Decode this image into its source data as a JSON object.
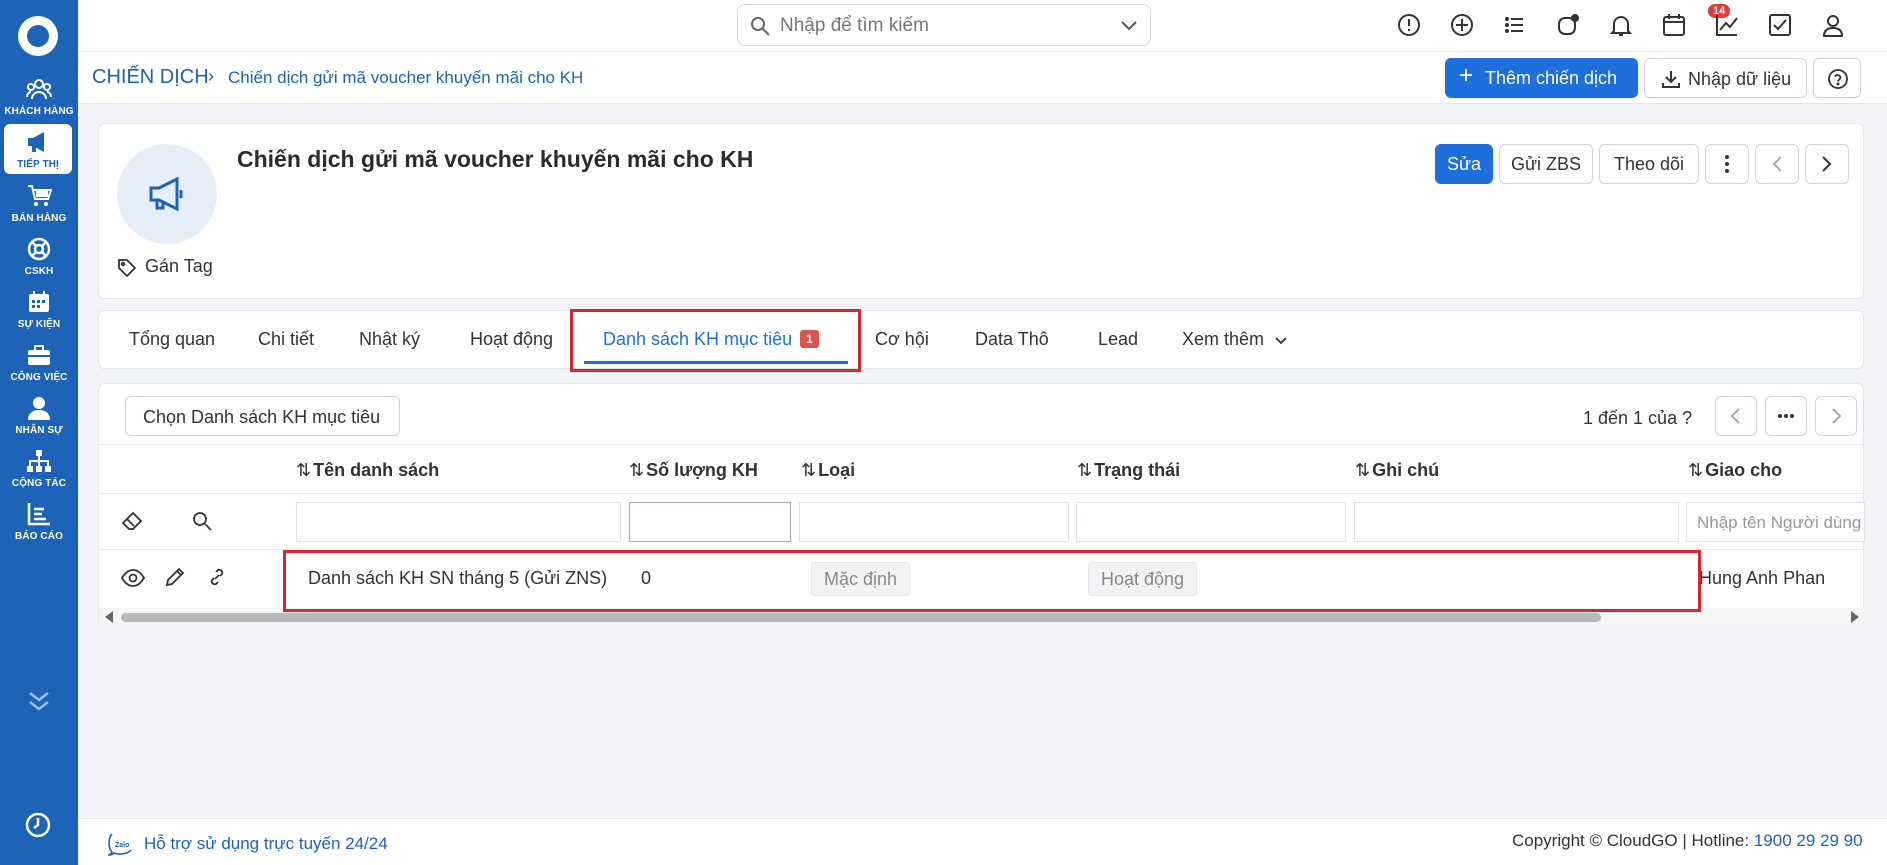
{
  "sidebar": {
    "items": [
      {
        "label": "KHÁCH HÀNG",
        "icon": "users-icon"
      },
      {
        "label": "TIẾP THỊ",
        "icon": "megaphone-icon"
      },
      {
        "label": "BÁN HÀNG",
        "icon": "cart-icon"
      },
      {
        "label": "CSKH",
        "icon": "lifebuoy-icon"
      },
      {
        "label": "SỰ KIỆN",
        "icon": "calendar-icon"
      },
      {
        "label": "CÔNG VIỆC",
        "icon": "briefcase-icon"
      },
      {
        "label": "NHÂN SỰ",
        "icon": "person-icon"
      },
      {
        "label": "CỘNG TÁC",
        "icon": "org-chart-icon"
      },
      {
        "label": "BÁO CÁO",
        "icon": "report-icon"
      }
    ]
  },
  "search": {
    "placeholder": "Nhập để tìm kiếm"
  },
  "topbar": {
    "notification_count": "14"
  },
  "breadcrumb": {
    "root": "CHIẾN DỊCH",
    "separator": "›",
    "current": "Chiến dịch gửi mã voucher khuyến mãi cho KH"
  },
  "actions": {
    "add_campaign": "Thêm chiến dịch",
    "import": "Nhập dữ liệu"
  },
  "campaign": {
    "title": "Chiến dịch gửi mã voucher khuyến mãi cho KH",
    "tag_label": "Gán Tag"
  },
  "header_buttons": {
    "edit": "Sửa",
    "send_zbs": "Gửi ZBS",
    "follow": "Theo dõi"
  },
  "tabs": [
    {
      "label": "Tổng quan"
    },
    {
      "label": "Chi tiết"
    },
    {
      "label": "Nhật ký"
    },
    {
      "label": "Hoạt động"
    },
    {
      "label": "Danh sách KH mục tiêu",
      "count": "1"
    },
    {
      "label": "Cơ hội"
    },
    {
      "label": "Data Thô"
    },
    {
      "label": "Lead"
    },
    {
      "label": "Xem thêm"
    }
  ],
  "list": {
    "choose_button": "Chọn Danh sách KH mục tiêu",
    "pager_text": "1 đến 1 của ?",
    "columns": [
      "Tên danh sách",
      "Số lượng KH",
      "Loại",
      "Trạng thái",
      "Ghi chú",
      "Giao cho"
    ],
    "assignee_placeholder": "Nhập tên Người dùng",
    "rows": [
      {
        "name": "Danh sách KH SN tháng 5 (Gửi ZNS)",
        "count": "0",
        "type": "Mặc định",
        "status": "Hoạt động",
        "note": "",
        "assignee": "Hung Anh Phan"
      }
    ]
  },
  "footer": {
    "support": "Hỗ trợ sử dụng trực tuyến 24/24",
    "copyright": "Copyright © CloudGO",
    "hotline_label": "Hotline:",
    "hotline": "1900 29 29 90"
  },
  "colors": {
    "brand": "#1d63b8",
    "primary_button": "#1d6fde",
    "highlight_box": "#d9252b",
    "tab_badge": "#d9534f"
  }
}
